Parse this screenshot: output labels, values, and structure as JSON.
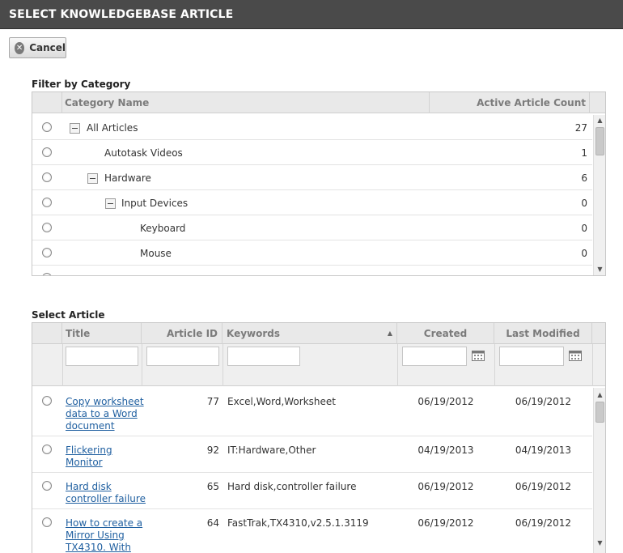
{
  "window": {
    "title": "SELECT KNOWLEDGEBASE ARTICLE"
  },
  "toolbar": {
    "cancel_label": "Cancel"
  },
  "category_section": {
    "label": "Filter by Category",
    "columns": {
      "name": "Category Name",
      "count": "Active Article Count"
    },
    "rows": [
      {
        "name": "All Articles",
        "count": "27"
      },
      {
        "name": "Autotask Videos",
        "count": "1"
      },
      {
        "name": "Hardware",
        "count": "6"
      },
      {
        "name": "Input Devices",
        "count": "0"
      },
      {
        "name": "Keyboard",
        "count": "0"
      },
      {
        "name": "Mouse",
        "count": "0"
      }
    ]
  },
  "article_section": {
    "label": "Select Article",
    "columns": {
      "title": "Title",
      "id": "Article ID",
      "keywords": "Keywords",
      "created": "Created",
      "modified": "Last Modified"
    },
    "sort_indicator": "▲",
    "rows": [
      {
        "title_lines": [
          "Copy worksheet",
          "data to a Word",
          "document"
        ],
        "id": "77",
        "keywords": "Excel,Word,Worksheet",
        "created": "06/19/2012",
        "modified": "06/19/2012"
      },
      {
        "title_lines": [
          "Flickering",
          "Monitor"
        ],
        "id": "92",
        "keywords": "IT:Hardware,Other",
        "created": "04/19/2013",
        "modified": "04/19/2013"
      },
      {
        "title_lines": [
          "Hard disk",
          "controller failure"
        ],
        "id": "65",
        "keywords": "Hard disk,controller failure",
        "created": "06/19/2012",
        "modified": "06/19/2012"
      },
      {
        "title_lines": [
          "How to create a",
          "Mirror Using",
          "TX4310. With"
        ],
        "id": "64",
        "keywords": "FastTrak,TX4310,v2.5.1.3119",
        "created": "06/19/2012",
        "modified": "06/19/2012"
      }
    ]
  }
}
